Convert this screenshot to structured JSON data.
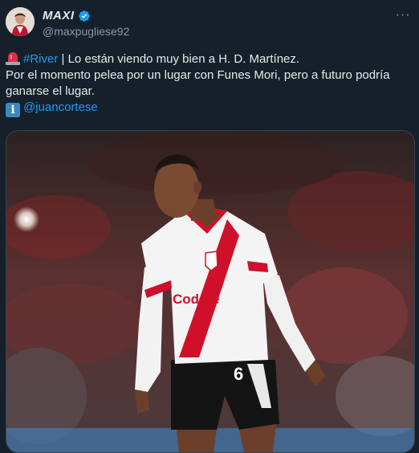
{
  "author": {
    "display_name": "MAXI",
    "handle": "@maxpugliese92",
    "verified": true
  },
  "tweet": {
    "hashtag": "#River",
    "line1_rest": " | Lo están viendo muy bien a H. D. Martínez.",
    "line2": "Por el momento pelea por un lugar con Funes Mori, pero a futuro podría",
    "line3": "ganarse el lugar.",
    "mention": "@juancortese",
    "icons": [
      "siren-icon",
      "information-icon"
    ]
  },
  "media": {
    "jersey_sponsor": "Codere",
    "jersey_number": "6"
  },
  "colors": {
    "background": "#15202b",
    "link": "#1d9bf0",
    "verified": "#1d9bf0",
    "secondary_text": "#8b98a5",
    "river_red": "#d0102a"
  }
}
